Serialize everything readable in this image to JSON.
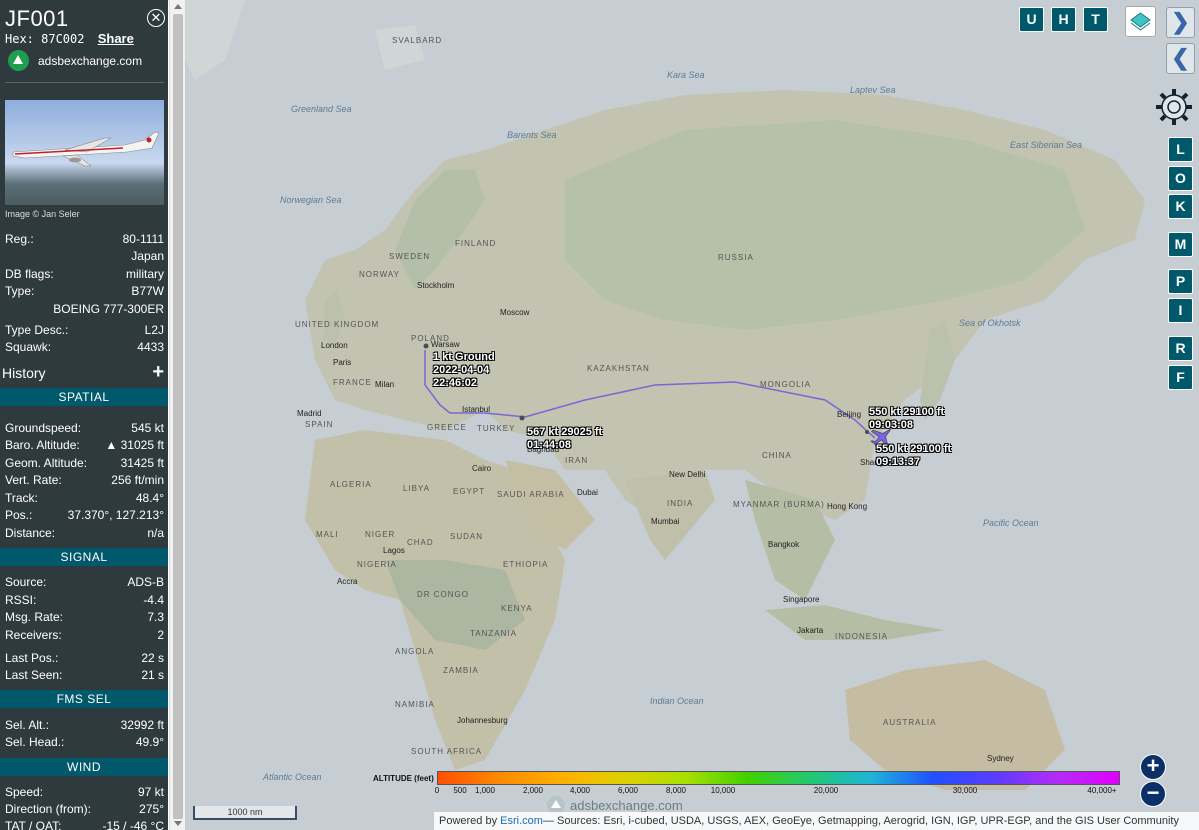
{
  "sidebar": {
    "callsign": "JF001",
    "hex_label": "Hex: 87C002",
    "share_label": "Share",
    "brand": "adsbexchange.com",
    "photo_credit": "Image © Jan Seler",
    "info": [
      {
        "label": "Reg.:",
        "value": "80-1111"
      },
      {
        "label": "",
        "value": "Japan"
      },
      {
        "label": "DB flags:",
        "value": "military"
      },
      {
        "label": "Type:",
        "value": "B77W"
      },
      {
        "label": "",
        "value": "BOEING 777-300ER"
      },
      {
        "label": "Type Desc.:",
        "value": "L2J"
      },
      {
        "label": "Squawk:",
        "value": "4433"
      }
    ],
    "history_label": "History",
    "history_plus": "+",
    "spatial": {
      "title": "SPATIAL",
      "rows": [
        {
          "label": "Groundspeed:",
          "value": "545 kt"
        },
        {
          "label": "Baro. Altitude:",
          "value": "▲ 31025 ft"
        },
        {
          "label": "Geom. Altitude:",
          "value": "31425 ft"
        },
        {
          "label": "Vert. Rate:",
          "value": "256 ft/min"
        },
        {
          "label": "Track:",
          "value": "48.4°"
        },
        {
          "label": "Pos.:",
          "value": "37.370°, 127.213°"
        },
        {
          "label": "Distance:",
          "value": "n/a"
        }
      ]
    },
    "signal": {
      "title": "SIGNAL",
      "rows": [
        {
          "label": "Source:",
          "value": "ADS-B"
        },
        {
          "label": "RSSI:",
          "value": "-4.4"
        },
        {
          "label": "Msg. Rate:",
          "value": "7.3"
        },
        {
          "label": "Receivers:",
          "value": "2"
        },
        {
          "label": "Last Pos.:",
          "value": "22 s"
        },
        {
          "label": "Last Seen:",
          "value": "21 s"
        }
      ]
    },
    "fms": {
      "title": "FMS SEL",
      "rows": [
        {
          "label": "Sel. Alt.:",
          "value": "32992 ft"
        },
        {
          "label": "Sel. Head.:",
          "value": "49.9°"
        }
      ]
    },
    "wind": {
      "title": "WIND",
      "rows": [
        {
          "label": "Speed:",
          "value": "97 kt"
        },
        {
          "label": "Direction (from):",
          "value": "275°"
        },
        {
          "label": "TAT / OAT:",
          "value": "-15 / -46 °C"
        }
      ]
    }
  },
  "map": {
    "top_buttons": [
      "U",
      "H",
      "T"
    ],
    "side_buttons": [
      "L",
      "O",
      "K",
      "M",
      "P",
      "I",
      "R",
      "F"
    ],
    "nav_forward": "❯",
    "nav_back": "❮",
    "zoom_in": "+",
    "zoom_out": "−",
    "scale_label": "1000 nm",
    "watermark": "adsbexchange.com",
    "attribution_prefix": "Powered by ",
    "attribution_link": "Esri.com",
    "attribution_rest": "— Sources: Esri, i-cubed, USDA, USGS, AEX, GeoEye, Getmapping, Aerogrid, IGN, IGP, UPR-EGP, and the GIS User Community",
    "altitude_legend": {
      "label": "ALTITUDE (feet)",
      "ticks": [
        "0",
        "500",
        "1,000",
        "2,000",
        "4,000",
        "6,000",
        "8,000",
        "10,000",
        "20,000",
        "30,000",
        "40,000+"
      ]
    },
    "track_labels": [
      {
        "line1": "1 kt  Ground",
        "line2": "2022-04-04",
        "line3": "22:46:02"
      },
      {
        "line1": "567 kt  29025 ft",
        "line2": "01:44:08"
      },
      {
        "line1": "550 kt  29100 ft",
        "line2": "09:03:08"
      },
      {
        "line1": "550 kt  29100 ft",
        "line2": "09:13:37"
      }
    ],
    "places": [
      "London",
      "Paris",
      "Madrid",
      "Milan",
      "Warsaw",
      "Moscow",
      "Stockholm",
      "Istanbul",
      "Cairo",
      "Dubai",
      "Baghdad",
      "New Delhi",
      "Mumbai",
      "Beijing",
      "Shanghai",
      "Hong Kong",
      "Bangkok",
      "Singapore",
      "Jakarta",
      "Accra",
      "Johannesburg",
      "Sydney",
      "Lagos"
    ],
    "regions": [
      "RUSSIA",
      "KAZAKHSTAN",
      "MONGOLIA",
      "CHINA",
      "INDIA",
      "IRAN",
      "TURKEY",
      "EGYPT",
      "LIBYA",
      "ALGERIA",
      "MALI",
      "NIGER",
      "CHAD",
      "SUDAN",
      "NIGERIA",
      "ETHIOPIA",
      "DR CONGO",
      "KENYA",
      "TANZANIA",
      "ANGOLA",
      "ZAMBIA",
      "NAMIBIA",
      "SOUTH AFRICA",
      "SAUDI ARABIA",
      "SWEDEN",
      "NORWAY",
      "FINLAND",
      "POLAND",
      "UNITED KINGDOM",
      "FRANCE",
      "SPAIN",
      "GREECE",
      "MYANMAR (BURMA)",
      "INDONESIA",
      "AUSTRALIA",
      "SVALBARD"
    ],
    "oceans": [
      "Greenland Sea",
      "Norwegian Sea",
      "Kara Sea",
      "Laptev Sea",
      "Barents Sea",
      "East Siberian Sea",
      "Sea of Okhotsk",
      "Indian Ocean",
      "Pacific Ocean",
      "Atlantic Ocean"
    ]
  }
}
